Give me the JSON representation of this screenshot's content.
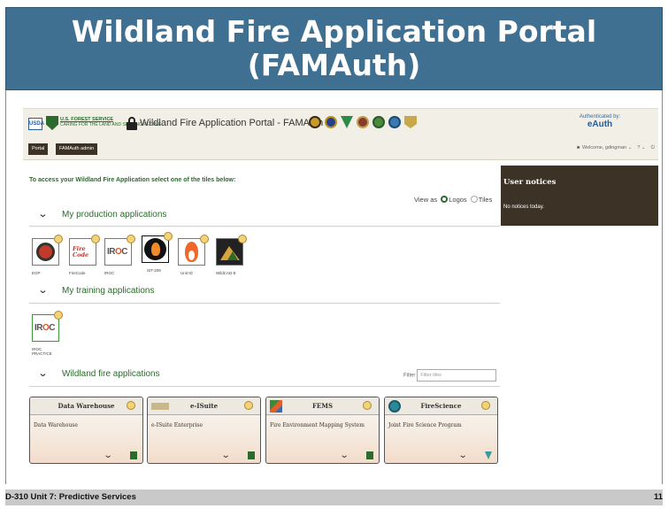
{
  "slide": {
    "title_line1": "Wildland Fire Application Portal",
    "title_line2": "(FAMAuth)",
    "footer_left": "D-310 Unit 7: Predictive Services",
    "page_number": "11"
  },
  "colors": {
    "banner": "#3f6f91",
    "green": "#2d6a2d",
    "dark_brown": "#3d3226",
    "header_bg": "#f1efe6"
  },
  "header": {
    "usda_label": "USDA",
    "fs_name": "U.S. FOREST SERVICE",
    "fs_motto": "CARING FOR THE LAND AND SERVING PEOPLE",
    "portal_title": "Wildland Fire Application Portal - FAMAuth",
    "auth_label": "Authenticated by:",
    "auth_provider": "eAuth",
    "welcome": "Welcome, gdingman",
    "nav": [
      "Portal",
      "FAMAuth admin"
    ]
  },
  "main": {
    "instructions": "To access your Wildland Fire Application select one of the tiles below:",
    "view_as_label": "View as",
    "view_options": [
      "Logos",
      "Tiles"
    ],
    "view_selected": "Logos",
    "sections": {
      "production": "My production applications",
      "training": "My training applications",
      "wildland": "Wildland fire applications"
    },
    "production_apps": [
      "EGP",
      "FireCode",
      "IROC",
      "SIT-209",
      "Unit ID",
      "WildCAD-E"
    ],
    "training_apps": [
      "IROC PRACTICE"
    ],
    "filter_label": "Filter",
    "filter_placeholder": "Filter tiles",
    "cards": [
      {
        "name": "Data Warehouse",
        "desc": "Data Warehouse"
      },
      {
        "name": "e-ISuite",
        "desc": "e-ISuite Enterprise"
      },
      {
        "name": "FEMS",
        "desc": "Fire Environment Mapping System"
      },
      {
        "name": "FireScience",
        "desc": "Joint Fire Science Program"
      }
    ]
  },
  "notices": {
    "title": "User notices",
    "body": "No notices today."
  }
}
